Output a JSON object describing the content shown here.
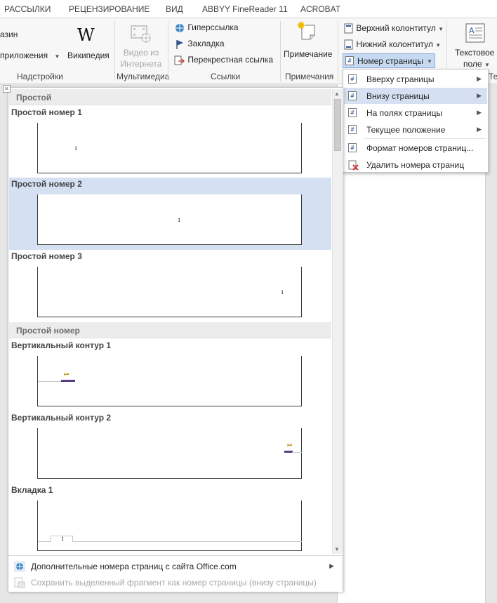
{
  "menu_tabs": [
    "РАССЫЛКИ",
    "РЕЦЕНЗИРОВАНИЕ",
    "ВИД",
    "ABBYY FineReader 11",
    "ACROBAT"
  ],
  "ribbon": {
    "addins": {
      "store_fragment": "азин",
      "apps_label": "приложения",
      "wikipedia_label": "Википедия",
      "group_label": "Надстройки"
    },
    "media": {
      "online_video_line1": "Видео из",
      "online_video_line2": "Интернета",
      "group_label": "Мультимедиа"
    },
    "links": {
      "hyperlink": "Гиперссылка",
      "bookmark": "Закладка",
      "cross_reference": "Перекрестная ссылка",
      "group_label": "Ссылки"
    },
    "comments": {
      "comment": "Примечание",
      "group_label": "Примечания"
    },
    "header_footer": {
      "header": "Верхний колонтитул",
      "footer": "Нижний колонтитул",
      "page_number": "Номер страницы"
    },
    "text": {
      "textbox_line1": "Текстовое",
      "textbox_line2": "поле",
      "group_fragment": "Те"
    }
  },
  "submenu": {
    "items": [
      {
        "label": "Вверху страницы",
        "has_submenu": true
      },
      {
        "label": "Внизу страницы",
        "has_submenu": true,
        "highlighted": true
      },
      {
        "label": "На полях страницы",
        "has_submenu": true
      },
      {
        "label": "Текущее положение",
        "has_submenu": true
      },
      {
        "label": "Формат номеров страниц..."
      },
      {
        "label": "Удалить номера страниц"
      }
    ]
  },
  "gallery": {
    "sections": [
      "Простой",
      "Простой номер"
    ],
    "items": [
      {
        "title": "Простой номер 1",
        "page_number": "1"
      },
      {
        "title": "Простой номер 2",
        "page_number": "1",
        "selected": true
      },
      {
        "title": "Простой номер 3",
        "page_number": "1"
      },
      {
        "title": "Вертикальный контур 1",
        "page_number": "1"
      },
      {
        "title": "Вертикальный контур 2",
        "page_number": "1"
      },
      {
        "title": "Вкладка 1",
        "page_number": "1"
      }
    ],
    "footer": {
      "more_numbers": "Дополнительные номера страниц с сайта Office.com",
      "save_selection": "Сохранить выделенный фрагмент как номер страницы (внизу страницы)"
    }
  },
  "colors": {
    "highlight": "#d5e1f2",
    "ribbon_bg": "#f7f7f7",
    "accent_blue": "#2b579a",
    "vertical_outline_bar": "#5a3c84",
    "vertical_outline_number": "#b58a00"
  }
}
